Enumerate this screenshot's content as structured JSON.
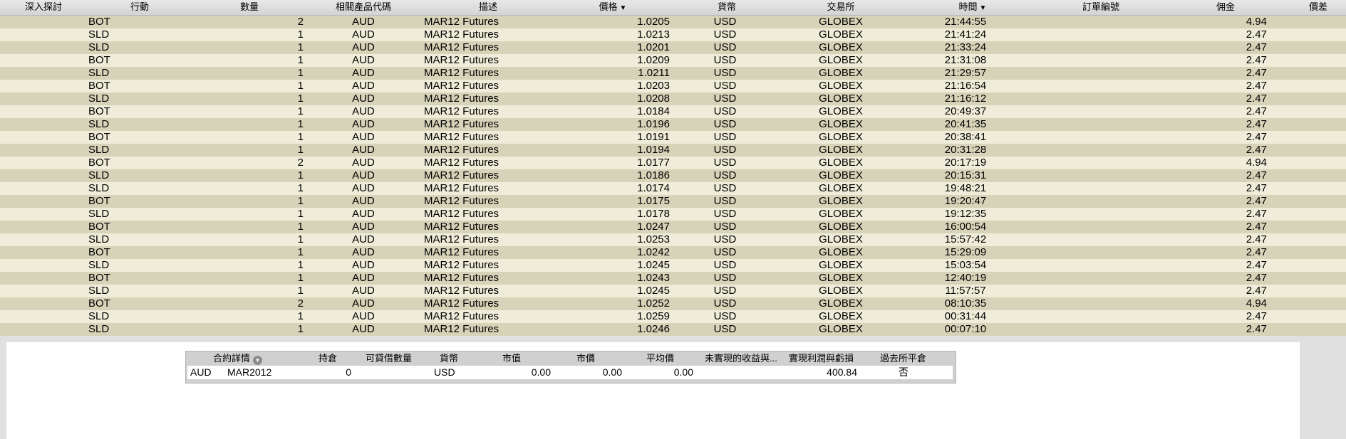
{
  "columns": {
    "deep": "深入探討",
    "action": "行動",
    "qty": "數量",
    "symbol": "相關產品代碼",
    "desc": "描述",
    "price": "價格",
    "currency": "貨幣",
    "exchange": "交易所",
    "time": "時間",
    "order_id": "訂單編號",
    "commission": "佣金",
    "spread": "價差"
  },
  "trades": [
    {
      "action": "BOT",
      "qty": "2",
      "symbol": "AUD",
      "desc": "MAR12 Futures",
      "price": "1.0205",
      "currency": "USD",
      "exchange": "GLOBEX",
      "time": "21:44:55",
      "commission": "4.94"
    },
    {
      "action": "SLD",
      "qty": "1",
      "symbol": "AUD",
      "desc": "MAR12 Futures",
      "price": "1.0213",
      "currency": "USD",
      "exchange": "GLOBEX",
      "time": "21:41:24",
      "commission": "2.47"
    },
    {
      "action": "SLD",
      "qty": "1",
      "symbol": "AUD",
      "desc": "MAR12 Futures",
      "price": "1.0201",
      "currency": "USD",
      "exchange": "GLOBEX",
      "time": "21:33:24",
      "commission": "2.47"
    },
    {
      "action": "BOT",
      "qty": "1",
      "symbol": "AUD",
      "desc": "MAR12 Futures",
      "price": "1.0209",
      "currency": "USD",
      "exchange": "GLOBEX",
      "time": "21:31:08",
      "commission": "2.47"
    },
    {
      "action": "SLD",
      "qty": "1",
      "symbol": "AUD",
      "desc": "MAR12 Futures",
      "price": "1.0211",
      "currency": "USD",
      "exchange": "GLOBEX",
      "time": "21:29:57",
      "commission": "2.47"
    },
    {
      "action": "BOT",
      "qty": "1",
      "symbol": "AUD",
      "desc": "MAR12 Futures",
      "price": "1.0203",
      "currency": "USD",
      "exchange": "GLOBEX",
      "time": "21:16:54",
      "commission": "2.47"
    },
    {
      "action": "SLD",
      "qty": "1",
      "symbol": "AUD",
      "desc": "MAR12 Futures",
      "price": "1.0208",
      "currency": "USD",
      "exchange": "GLOBEX",
      "time": "21:16:12",
      "commission": "2.47"
    },
    {
      "action": "BOT",
      "qty": "1",
      "symbol": "AUD",
      "desc": "MAR12 Futures",
      "price": "1.0184",
      "currency": "USD",
      "exchange": "GLOBEX",
      "time": "20:49:37",
      "commission": "2.47"
    },
    {
      "action": "SLD",
      "qty": "1",
      "symbol": "AUD",
      "desc": "MAR12 Futures",
      "price": "1.0196",
      "currency": "USD",
      "exchange": "GLOBEX",
      "time": "20:41:35",
      "commission": "2.47"
    },
    {
      "action": "BOT",
      "qty": "1",
      "symbol": "AUD",
      "desc": "MAR12 Futures",
      "price": "1.0191",
      "currency": "USD",
      "exchange": "GLOBEX",
      "time": "20:38:41",
      "commission": "2.47"
    },
    {
      "action": "SLD",
      "qty": "1",
      "symbol": "AUD",
      "desc": "MAR12 Futures",
      "price": "1.0194",
      "currency": "USD",
      "exchange": "GLOBEX",
      "time": "20:31:28",
      "commission": "2.47"
    },
    {
      "action": "BOT",
      "qty": "2",
      "symbol": "AUD",
      "desc": "MAR12 Futures",
      "price": "1.0177",
      "currency": "USD",
      "exchange": "GLOBEX",
      "time": "20:17:19",
      "commission": "4.94"
    },
    {
      "action": "SLD",
      "qty": "1",
      "symbol": "AUD",
      "desc": "MAR12 Futures",
      "price": "1.0186",
      "currency": "USD",
      "exchange": "GLOBEX",
      "time": "20:15:31",
      "commission": "2.47"
    },
    {
      "action": "SLD",
      "qty": "1",
      "symbol": "AUD",
      "desc": "MAR12 Futures",
      "price": "1.0174",
      "currency": "USD",
      "exchange": "GLOBEX",
      "time": "19:48:21",
      "commission": "2.47"
    },
    {
      "action": "BOT",
      "qty": "1",
      "symbol": "AUD",
      "desc": "MAR12 Futures",
      "price": "1.0175",
      "currency": "USD",
      "exchange": "GLOBEX",
      "time": "19:20:47",
      "commission": "2.47"
    },
    {
      "action": "SLD",
      "qty": "1",
      "symbol": "AUD",
      "desc": "MAR12 Futures",
      "price": "1.0178",
      "currency": "USD",
      "exchange": "GLOBEX",
      "time": "19:12:35",
      "commission": "2.47"
    },
    {
      "action": "BOT",
      "qty": "1",
      "symbol": "AUD",
      "desc": "MAR12 Futures",
      "price": "1.0247",
      "currency": "USD",
      "exchange": "GLOBEX",
      "time": "16:00:54",
      "commission": "2.47"
    },
    {
      "action": "SLD",
      "qty": "1",
      "symbol": "AUD",
      "desc": "MAR12 Futures",
      "price": "1.0253",
      "currency": "USD",
      "exchange": "GLOBEX",
      "time": "15:57:42",
      "commission": "2.47"
    },
    {
      "action": "BOT",
      "qty": "1",
      "symbol": "AUD",
      "desc": "MAR12 Futures",
      "price": "1.0242",
      "currency": "USD",
      "exchange": "GLOBEX",
      "time": "15:29:09",
      "commission": "2.47"
    },
    {
      "action": "SLD",
      "qty": "1",
      "symbol": "AUD",
      "desc": "MAR12 Futures",
      "price": "1.0245",
      "currency": "USD",
      "exchange": "GLOBEX",
      "time": "15:03:54",
      "commission": "2.47"
    },
    {
      "action": "BOT",
      "qty": "1",
      "symbol": "AUD",
      "desc": "MAR12 Futures",
      "price": "1.0243",
      "currency": "USD",
      "exchange": "GLOBEX",
      "time": "12:40:19",
      "commission": "2.47"
    },
    {
      "action": "SLD",
      "qty": "1",
      "symbol": "AUD",
      "desc": "MAR12 Futures",
      "price": "1.0245",
      "currency": "USD",
      "exchange": "GLOBEX",
      "time": "11:57:57",
      "commission": "2.47"
    },
    {
      "action": "BOT",
      "qty": "2",
      "symbol": "AUD",
      "desc": "MAR12 Futures",
      "price": "1.0252",
      "currency": "USD",
      "exchange": "GLOBEX",
      "time": "08:10:35",
      "commission": "4.94"
    },
    {
      "action": "SLD",
      "qty": "1",
      "symbol": "AUD",
      "desc": "MAR12 Futures",
      "price": "1.0259",
      "currency": "USD",
      "exchange": "GLOBEX",
      "time": "00:31:44",
      "commission": "2.47"
    },
    {
      "action": "SLD",
      "qty": "1",
      "symbol": "AUD",
      "desc": "MAR12 Futures",
      "price": "1.0246",
      "currency": "USD",
      "exchange": "GLOBEX",
      "time": "00:07:10",
      "commission": "2.47"
    }
  ],
  "contract": {
    "columns": {
      "details": "合約詳情",
      "position": "持倉",
      "borrowable": "可貸借數量",
      "currency": "貨幣",
      "market_value": "市值",
      "market_price": "市價",
      "avg_price": "平均價",
      "unrealized": "未實現的收益與...",
      "realized": "實現利潤與虧損",
      "past_close": "過去所平倉"
    },
    "row": {
      "symbol": "AUD",
      "expiry": "MAR2012",
      "position": "0",
      "currency": "USD",
      "market_value": "0.00",
      "market_price": "0.00",
      "avg_price": "0.00",
      "realized": "400.84",
      "past_close": "否"
    }
  },
  "icons": {
    "sort_desc": "sort-descending-icon",
    "filter": "filter-dropdown-icon"
  },
  "colors": {
    "row_dark": "#d6d3b8",
    "row_light": "#efedd9",
    "panel": "#ffffff",
    "background": "#e0e0e0"
  }
}
